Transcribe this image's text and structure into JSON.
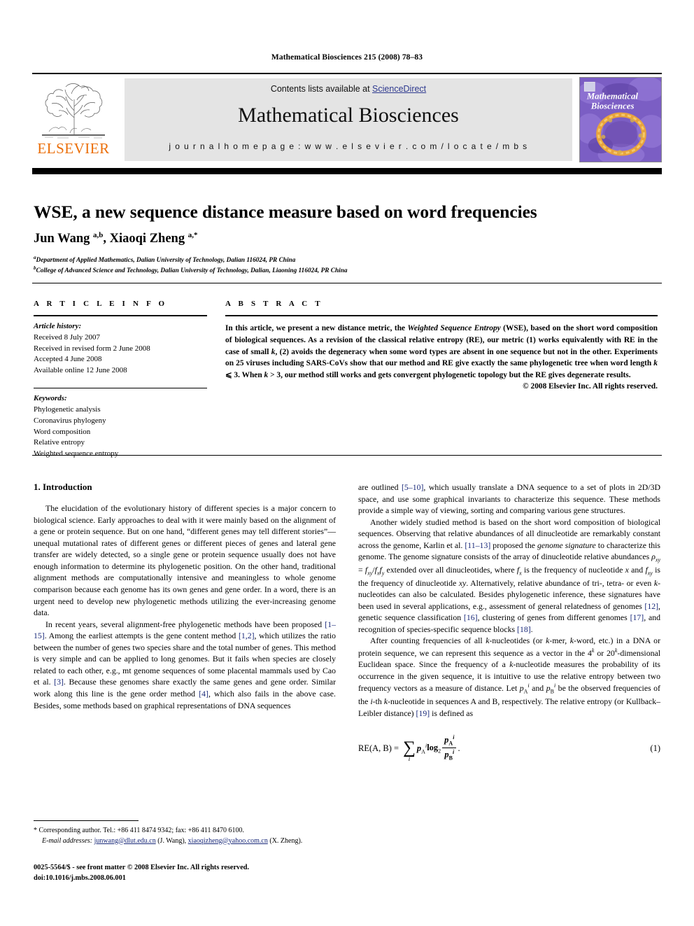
{
  "running_head": "Mathematical Biosciences 215 (2008) 78–83",
  "header": {
    "contents_prefix": "Contents lists available at ",
    "sciencedirect": "ScienceDirect",
    "journal_name": "Mathematical Biosciences",
    "homepage": "j o u r n a l   h o m e p a g e :   w w w . e l s e v i e r . c o m / l o c a t e / m b s",
    "elsevier_wordmark": "ELSEVIER",
    "cover_title_line1": "Mathematical",
    "cover_title_line2": "Biosciences",
    "link_color": "#2f3a8f",
    "elsevier_orange": "#eb6e08"
  },
  "article": {
    "title": "WSE, a new sequence distance measure based on word frequencies",
    "authors_html": "Jun Wang <sup>a,b</sup>, Xiaoqi Zheng <sup>a,</sup><sup>*</sup>",
    "affiliations": [
      "Department of Applied Mathematics, Dalian University of Technology, Dalian 116024, PR China",
      "College of Advanced Science and Technology, Dalian University of Technology, Dalian, Liaoning 116024, PR China"
    ],
    "affiliation_marks": [
      "a",
      "b"
    ]
  },
  "info": {
    "heading": "A R T I C L E  I N F O",
    "history_label": "Article history:",
    "history": [
      "Received 8 July 2007",
      "Received in revised form 2 June 2008",
      "Accepted 4 June 2008",
      "Available online 12 June 2008"
    ],
    "keywords_label": "Keywords:",
    "keywords": [
      "Phylogenetic analysis",
      "Coronavirus phylogeny",
      "Word composition",
      "Relative entropy",
      "Weighted sequence entropy"
    ]
  },
  "abstract": {
    "heading": "A B S T R A C T",
    "text_parts": [
      "In this article, we present a new distance metric, the ",
      "Weighted Sequence Entropy",
      " (WSE), based on the short word composition of biological sequences. As a revision of the classical relative entropy (RE), our metric (1) works equivalently with RE in the case of small ",
      "k",
      ", (2) avoids the degeneracy when some word types are absent in one sequence but not in the other. Experiments on 25 viruses including SARS-CoVs show that our method and RE give exactly the same phylogenetic tree when word length ",
      "k",
      " ⩽ 3. When ",
      "k",
      " > 3, our method still works and gets convergent phylogenetic topology but the RE gives degenerate results."
    ],
    "copyright": "© 2008 Elsevier Inc. All rights reserved."
  },
  "section": {
    "intro_heading": "1. Introduction"
  },
  "left_column": {
    "p1": "The elucidation of the evolutionary history of different species is a major concern to biological science. Early approaches to deal with it were mainly based on the alignment of a gene or protein sequence. But on one hand, “different genes may tell different stories”—unequal mutational rates of different genes or different pieces of genes and lateral gene transfer are widely detected, so a single gene or protein sequence usually does not have enough information to determine its phylogenetic position. On the other hand, traditional alignment methods are computationally intensive and meaningless to whole genome comparison because each genome has its own genes and gene order. In a word, there is an urgent need to develop new phylogenetic methods utilizing the ever-increasing genome data.",
    "p2_a": "In recent years, several alignment-free phylogenetic methods have been proposed ",
    "p2_ref1": "[1–15]",
    "p2_b": ". Among the earliest attempts is the gene content method ",
    "p2_ref2": "[1,2]",
    "p2_c": ", which utilizes the ratio between the number of genes two species share and the total number of genes. This method is very simple and can be applied to long genomes. But it fails when species are closely related to each other, e.g., mt genome sequences of some placental mammals used by Cao et al. ",
    "p2_ref3": "[3]",
    "p2_d": ". Because these genomes share exactly the same genes and gene order. Similar work along this line is the gene order method ",
    "p2_ref4": "[4]",
    "p2_e": ", which also fails in the above case. Besides, some methods based on graphical representations of DNA sequences"
  },
  "right_column": {
    "p1_a": "are outlined ",
    "p1_ref": "[5–10]",
    "p1_b": ", which usually translate a DNA sequence to a set of plots in 2D/3D space, and use some graphical invariants to characterize this sequence. These methods provide a simple way of viewing, sorting and comparing various gene structures.",
    "p2_a": "Another widely studied method is based on the short word composition of biological sequences. Observing that relative abundances of all dinucleotide are remarkably constant across the genome, Karlin et al. ",
    "p2_ref1": "[11–13]",
    "p2_b": " proposed the ",
    "p2_it1": "genome signature",
    "p2_c": " to characterize this genome. The genome signature consists of the array of dinucleotide relative abundances ρxy = fxy/fxfy extended over all dinucleotides, where fx is the frequency of nucleotide x and fxy is the frequency of dinucleotide xy. Alternatively, relative abundance of tri-, tetra- or even k-nucleotides can also be calculated. Besides phylogenetic inference, these signatures have been used in several applications, e.g., assessment of general relatedness of genomes ",
    "p2_ref2": "[12]",
    "p2_d": ", genetic sequence classification ",
    "p2_ref3": "[16]",
    "p2_e": ", clustering of genes from different genomes ",
    "p2_ref4": "[17]",
    "p2_f": ", and recognition of species-specific sequence blocks ",
    "p2_ref5": "[18]",
    "p2_g": ".",
    "p3_a": "After counting frequencies of all k-nucleotides (or k-mer, k-word, etc.) in a DNA or protein sequence, we can represent this sequence as a vector in the 4k or 20k-dimensional Euclidean space. Since the frequency of a k-nucleotide measures the probability of its occurrence in the given sequence, it is intuitive to use the relative entropy between two frequency vectors as a measure of distance. Let piA and piB be the observed frequencies of the i-th k-nucleotide in sequences A and B, respectively. The relative entropy (or Kullback–Leibler distance) ",
    "p3_ref": "[19]",
    "p3_b": " is defined as"
  },
  "equation": {
    "lhs": "RE(A, B) =",
    "sum_symbol": "∑",
    "sum_index": "i",
    "factor": "p",
    "factor_sub": "A",
    "factor_sup": "i",
    "log": "log",
    "log_base": "2",
    "num": "p",
    "num_sub": "A",
    "num_sup": "i",
    "den": "p",
    "den_sub": "B",
    "den_sup": "i",
    "period": ".",
    "number": "(1)"
  },
  "footnotes": {
    "star": "*",
    "corresponding": " Corresponding author. Tel.: +86 411 8474 9342; fax: +86 411 8470 6100.",
    "email_label": "E-mail addresses:",
    "email1": "junwang@dlut.edu.cn",
    "email1_owner": " (J. Wang), ",
    "email2": "xiaoqizheng@yahoo.com.cn",
    "email2_owner": " (X. Zheng)."
  },
  "imprint": {
    "line1": "0025-5564/$ - see front matter © 2008 Elsevier Inc. All rights reserved.",
    "line2": "doi:10.1016/j.mbs.2008.06.001"
  }
}
